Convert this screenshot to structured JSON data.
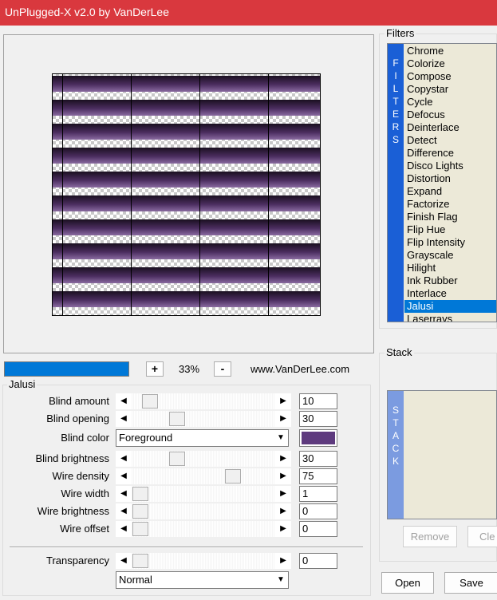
{
  "window": {
    "title": "UnPlugged-X v2.0 by VanDerLee"
  },
  "zoom": {
    "minus": "-",
    "plus": "+",
    "value": "33%",
    "website": "www.VanDerLee.com",
    "progress": 1.0
  },
  "params": {
    "group_title": "Jalusi",
    "rows": [
      {
        "label": "Blind amount",
        "value": "10"
      },
      {
        "label": "Blind opening",
        "value": "30"
      },
      {
        "label": "Blind brightness",
        "value": "30"
      },
      {
        "label": "Wire density",
        "value": "75"
      },
      {
        "label": "Wire width",
        "value": "1"
      },
      {
        "label": "Wire brightness",
        "value": "0"
      },
      {
        "label": "Wire offset",
        "value": "0"
      }
    ],
    "blind_color": {
      "label": "Blind color",
      "selected": "Foreground",
      "swatch": "#5e3a7e"
    },
    "transparency": {
      "label": "Transparency",
      "value": "0"
    },
    "blend_mode": {
      "selected": "Normal"
    }
  },
  "filters": {
    "group_title": "Filters",
    "side_label": [
      "F",
      "I",
      "L",
      "T",
      "E",
      "R",
      "S"
    ],
    "items": [
      "Chrome",
      "Colorize",
      "Compose",
      "Copystar",
      "Cycle",
      "Defocus",
      "Deinterlace",
      "Detect",
      "Difference",
      "Disco Lights",
      "Distortion",
      "Expand",
      "Factorize",
      "Finish Flag",
      "Flip Hue",
      "Flip Intensity",
      "Grayscale",
      "Hilight",
      "Ink Rubber",
      "Interlace",
      "Jalusi",
      "Laserrays"
    ],
    "selected": "Jalusi"
  },
  "stack": {
    "group_title": "Stack",
    "side_label": [
      "S",
      "T",
      "A",
      "C",
      "K"
    ],
    "remove_label": "Remove",
    "clear_label": "Cle"
  },
  "buttons": {
    "open": "Open",
    "save": "Save"
  },
  "colors": {
    "title_bar": "#d9383e",
    "selection": "#0078d7",
    "filters_bar": "#1a5fd6",
    "stack_bar": "#7b9be0"
  }
}
